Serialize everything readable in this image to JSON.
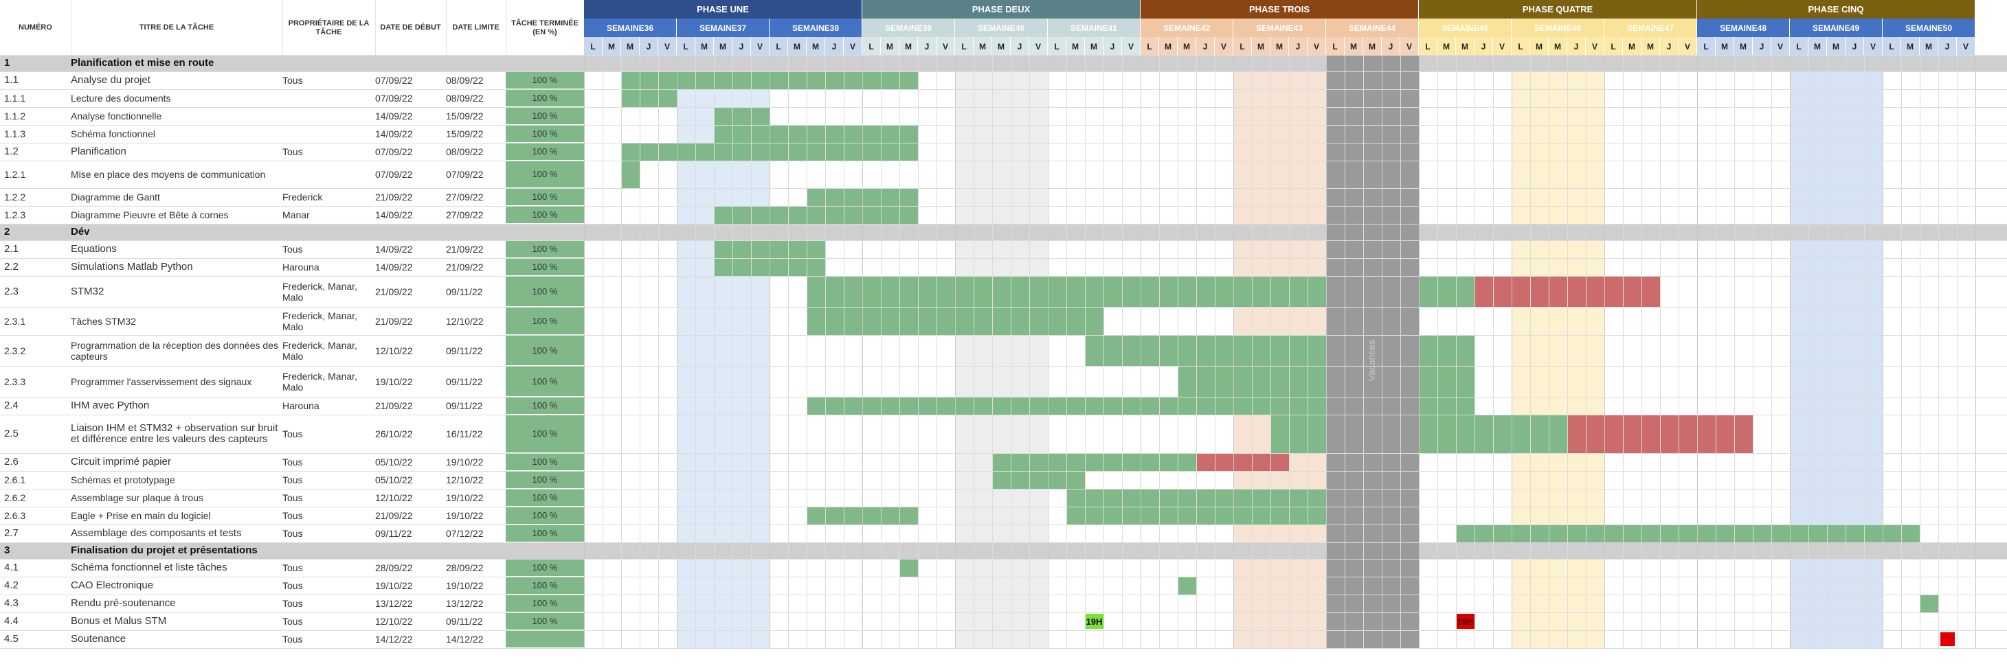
{
  "headers": {
    "numero": "NUMÉRO",
    "titre": "TITRE DE LA TÂCHE",
    "proprietaire": "PROPRIÉTAIRE DE LA TÂCHE",
    "debut": "DATE DE DÉBUT",
    "limite": "DATE LIMITE",
    "terminee": "TÂCHE TERMINÉE (EN %)"
  },
  "phases": [
    {
      "label": "PHASE UNE",
      "color": "#2e4e8c",
      "text": "#ffffff"
    },
    {
      "label": "PHASE DEUX",
      "color": "#5a8088",
      "text": "#ffffff"
    },
    {
      "label": "PHASE TROIS",
      "color": "#8b4513",
      "text": "#ffffff"
    },
    {
      "label": "PHASE QUATRE",
      "color": "#7a6010",
      "text": "#ffffff"
    },
    {
      "label": "PHASE CINQ",
      "color": "#7a6010",
      "text": "#ffffff"
    }
  ],
  "weeks": [
    {
      "label": "SEMAINE36",
      "phase": 0
    },
    {
      "label": "SEMAINE37",
      "phase": 0
    },
    {
      "label": "SEMAINE38",
      "phase": 0
    },
    {
      "label": "SEMAINE39",
      "phase": 1
    },
    {
      "label": "SEMAINE40",
      "phase": 1
    },
    {
      "label": "SEMAINE41",
      "phase": 1
    },
    {
      "label": "SEMAINE42",
      "phase": 2
    },
    {
      "label": "SEMAINE43",
      "phase": 2
    },
    {
      "label": "SEMAINE44",
      "phase": 2
    },
    {
      "label": "SEMAINE45",
      "phase": 3
    },
    {
      "label": "SEMAINE46",
      "phase": 3
    },
    {
      "label": "SEMAINE47",
      "phase": 3
    },
    {
      "label": "SEMAINE48",
      "phase": 4
    },
    {
      "label": "SEMAINE49",
      "phase": 4
    },
    {
      "label": "SEMAINE50",
      "phase": 4
    }
  ],
  "week_colors": {
    "0": {
      "week_bg": "#4472c4",
      "week_text": "#ffffff",
      "day_bg": "#c9d7ec"
    },
    "1": {
      "week_bg": "#c7d9da",
      "week_text": "#ffffff",
      "day_bg": "#d8e6e7"
    },
    "2": {
      "week_bg": "#f1c7a3",
      "week_text": "#ffffff",
      "day_bg": "#f3d2b7"
    },
    "3": {
      "week_bg": "#f9e39a",
      "week_text": "#ffffff",
      "day_bg": "#fbeaa7"
    },
    "4": {
      "week_bg": "#4472c4",
      "week_text": "#ffffff",
      "day_bg": "#c9d7ec"
    }
  },
  "shaded_weeks": {
    "1": "#deeaf6",
    "4": "#ededed",
    "7": "#f7e3d3",
    "10": "#fcf2cf",
    "13": "#d6e3f5"
  },
  "day_letters": [
    "L",
    "M",
    "M",
    "J",
    "V"
  ],
  "vacances": {
    "label": "Vacances",
    "week": 8
  },
  "rows": [
    {
      "num": "1",
      "title": "Planification et mise en route",
      "section": true
    },
    {
      "num": "1.1",
      "title": "Analyse du projet",
      "owner": "Tous",
      "start": "07/09/22",
      "end": "08/09/22",
      "pct": "100 %",
      "bars": [
        {
          "s": 2,
          "e": 17,
          "c": "g"
        }
      ]
    },
    {
      "num": "1.1.1",
      "title": "Lecture des documents",
      "owner": "",
      "start": "07/09/22",
      "end": "08/09/22",
      "pct": "100 %",
      "bars": [
        {
          "s": 2,
          "e": 4,
          "c": "g"
        }
      ]
    },
    {
      "num": "1.1.2",
      "title": "Analyse fonctionnelle",
      "owner": "",
      "start": "14/09/22",
      "end": "15/09/22",
      "pct": "100 %",
      "bars": [
        {
          "s": 7,
          "e": 9,
          "c": "g"
        }
      ]
    },
    {
      "num": "1.1.3",
      "title": "Schéma fonctionnel",
      "owner": "",
      "start": "14/09/22",
      "end": "15/09/22",
      "pct": "100 %",
      "bars": [
        {
          "s": 7,
          "e": 17,
          "c": "g"
        }
      ]
    },
    {
      "num": "1.2",
      "title": "Planification",
      "owner": "Tous",
      "start": "07/09/22",
      "end": "08/09/22",
      "pct": "100 %",
      "bars": [
        {
          "s": 2,
          "e": 17,
          "c": "g"
        }
      ]
    },
    {
      "num": "1.2.1",
      "title": "Mise en place des moyens de communication",
      "owner": "",
      "start": "07/09/22",
      "end": "07/09/22",
      "pct": "100 %",
      "bars": [
        {
          "s": 2,
          "e": 2,
          "c": "g"
        }
      ]
    },
    {
      "num": "1.2.2",
      "title": "Diagramme de Gantt",
      "owner": "Frederick",
      "start": "21/09/22",
      "end": "27/09/22",
      "pct": "100 %",
      "bars": [
        {
          "s": 12,
          "e": 17,
          "c": "g"
        }
      ]
    },
    {
      "num": "1.2.3",
      "title": "Diagramme Pieuvre et Bête à cornes",
      "owner": "Manar",
      "start": "14/09/22",
      "end": "27/09/22",
      "pct": "100 %",
      "bars": [
        {
          "s": 7,
          "e": 17,
          "c": "g"
        }
      ]
    },
    {
      "num": "2",
      "title": "Dév",
      "section": true
    },
    {
      "num": "2.1",
      "title": "Equations",
      "owner": "Tous",
      "start": "14/09/22",
      "end": "21/09/22",
      "pct": "100 %",
      "bars": [
        {
          "s": 7,
          "e": 12,
          "c": "g"
        }
      ]
    },
    {
      "num": "2.2",
      "title": "Simulations Matlab Python",
      "owner": "Harouna",
      "start": "14/09/22",
      "end": "21/09/22",
      "pct": "100 %",
      "bars": [
        {
          "s": 7,
          "e": 12,
          "c": "g"
        }
      ]
    },
    {
      "num": "2.3",
      "title": "STM32",
      "owner": "Frederick, Manar, Malo",
      "start": "21/09/22",
      "end": "09/11/22",
      "pct": "100 %",
      "bars": [
        {
          "s": 12,
          "e": 39,
          "c": "g"
        },
        {
          "s": 45,
          "e": 47,
          "c": "g"
        },
        {
          "s": 48,
          "e": 57,
          "c": "r"
        }
      ]
    },
    {
      "num": "2.3.1",
      "title": "Tâches STM32",
      "owner": "Frederick, Manar, Malo",
      "start": "21/09/22",
      "end": "12/10/22",
      "pct": "100 %",
      "bars": [
        {
          "s": 12,
          "e": 27,
          "c": "g"
        }
      ]
    },
    {
      "num": "2.3.2",
      "title": "Programmation de la réception des données des capteurs",
      "owner": "Frederick, Manar, Malo",
      "start": "12/10/22",
      "end": "09/11/22",
      "pct": "100 %",
      "bars": [
        {
          "s": 27,
          "e": 39,
          "c": "g"
        },
        {
          "s": 45,
          "e": 47,
          "c": "g"
        }
      ]
    },
    {
      "num": "2.3.3",
      "title": "Programmer l'asservissement des signaux",
      "owner": "Frederick, Manar, Malo",
      "start": "19/10/22",
      "end": "09/11/22",
      "pct": "100 %",
      "bars": [
        {
          "s": 32,
          "e": 39,
          "c": "g"
        },
        {
          "s": 45,
          "e": 47,
          "c": "g"
        }
      ]
    },
    {
      "num": "2.4",
      "title": "IHM avec Python",
      "owner": "Harouna",
      "start": "21/09/22",
      "end": "09/11/22",
      "pct": "100 %",
      "bars": [
        {
          "s": 12,
          "e": 39,
          "c": "g"
        },
        {
          "s": 45,
          "e": 47,
          "c": "g"
        }
      ]
    },
    {
      "num": "2.5",
      "title": "Liaison IHM et STM32 + observation sur bruit et différence entre les valeurs des capteurs",
      "owner": "Tous",
      "start": "26/10/22",
      "end": "16/11/22",
      "pct": "100 %",
      "bars": [
        {
          "s": 37,
          "e": 39,
          "c": "g"
        },
        {
          "s": 45,
          "e": 52,
          "c": "g"
        },
        {
          "s": 53,
          "e": 62,
          "c": "r"
        }
      ]
    },
    {
      "num": "2.6",
      "title": "Circuit imprimé papier",
      "owner": "Tous",
      "start": "05/10/22",
      "end": "19/10/22",
      "pct": "100 %",
      "bars": [
        {
          "s": 22,
          "e": 32,
          "c": "g"
        },
        {
          "s": 33,
          "e": 37,
          "c": "r"
        }
      ]
    },
    {
      "num": "2.6.1",
      "title": "Schémas et prototypage",
      "owner": "Tous",
      "start": "05/10/22",
      "end": "12/10/22",
      "pct": "100 %",
      "bars": [
        {
          "s": 22,
          "e": 26,
          "c": "g"
        }
      ]
    },
    {
      "num": "2.6.2",
      "title": "Assemblage sur plaque à trous",
      "owner": "Tous",
      "start": "12/10/22",
      "end": "19/10/22",
      "pct": "100 %",
      "bars": [
        {
          "s": 26,
          "e": 39,
          "c": "g"
        }
      ]
    },
    {
      "num": "2.6.3",
      "title": "Eagle + Prise en main du logiciel",
      "owner": "Tous",
      "start": "21/09/22",
      "end": "19/10/22",
      "pct": "100 %",
      "bars": [
        {
          "s": 12,
          "e": 17,
          "c": "g"
        },
        {
          "s": 26,
          "e": 39,
          "c": "g"
        }
      ]
    },
    {
      "num": "2.7",
      "title": "Assemblage des composants et tests",
      "owner": "Tous",
      "start": "09/11/22",
      "end": "07/12/22",
      "pct": "100 %",
      "bars": [
        {
          "s": 47,
          "e": 71,
          "c": "g"
        }
      ]
    },
    {
      "num": "3",
      "title": "Finalisation du projet et présentations",
      "section": true
    },
    {
      "num": "4.1",
      "title": "Schéma fonctionnel et liste tâches",
      "owner": "Tous",
      "start": "28/09/22",
      "end": "28/09/22",
      "pct": "100 %",
      "bars": [
        {
          "s": 17,
          "e": 17,
          "c": "g"
        }
      ]
    },
    {
      "num": "4.2",
      "title": "CAO Electronique",
      "owner": "Tous",
      "start": "19/10/22",
      "end": "19/10/22",
      "pct": "100 %",
      "bars": [
        {
          "s": 32,
          "e": 32,
          "c": "g"
        }
      ]
    },
    {
      "num": "4.3",
      "title": "Rendu pré-soutenance",
      "owner": "Tous",
      "start": "13/12/22",
      "end": "13/12/22",
      "pct": "100 %",
      "bars": [
        {
          "s": 72,
          "e": 72,
          "c": "g"
        }
      ]
    },
    {
      "num": "4.4",
      "title": "Bonus et Malus STM",
      "owner": "Tous",
      "start": "12/10/22",
      "end": "09/11/22",
      "pct": "100 %",
      "bars": [],
      "labels": [
        {
          "d": 27,
          "text": "19H",
          "bg": "#7ee03a",
          "color": "#111111"
        },
        {
          "d": 47,
          "text": "19H",
          "bg": "#d50000",
          "color": "#5a0000"
        }
      ]
    },
    {
      "num": "4.5",
      "title": "Soutenance",
      "owner": "Tous",
      "start": "14/12/22",
      "end": "14/12/22",
      "pct": "",
      "bars": [
        {
          "s": 73,
          "e": 73,
          "c": "red"
        }
      ]
    }
  ],
  "bar_colors": {
    "g": "#80b88a",
    "r": "#cc6b6b",
    "red": "#e00000"
  },
  "grid_color": "#dcdcdc",
  "section_bg": "#cfcfcf",
  "vacances_bg": "#9a9a9a"
}
